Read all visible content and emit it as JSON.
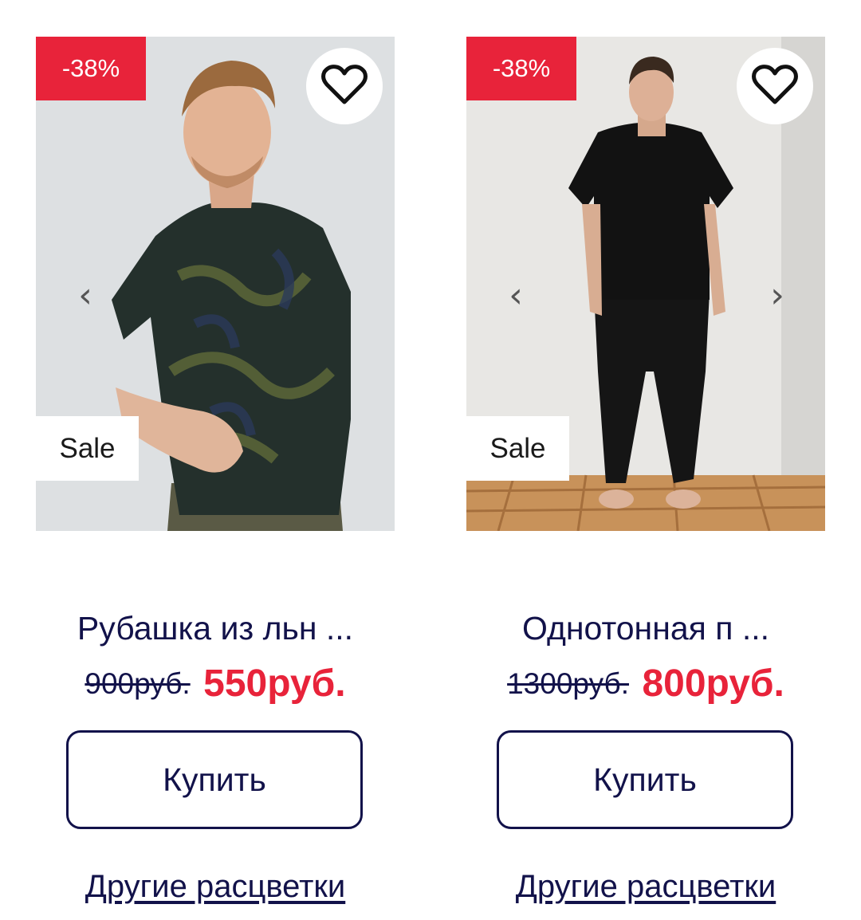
{
  "products": [
    {
      "discount": "-38%",
      "sale": "Sale",
      "title": "Рубашка из льн ...",
      "old_price": "900руб.",
      "new_price": "550руб.",
      "buy_label": "Купить",
      "other_colors_label": "Другие расцветки"
    },
    {
      "discount": "-38%",
      "sale": "Sale",
      "title": "Однотонная п ...",
      "old_price": "1300руб.",
      "new_price": "800руб.",
      "buy_label": "Купить",
      "other_colors_label": "Другие расцветки"
    }
  ],
  "icons": {
    "favorite": "heart-icon",
    "prev": "chevron-left-icon",
    "next": "chevron-right-icon",
    "prev_glyph": "‹",
    "next_glyph": "›"
  },
  "colors": {
    "accent": "#e8233a",
    "text": "#12124a"
  }
}
